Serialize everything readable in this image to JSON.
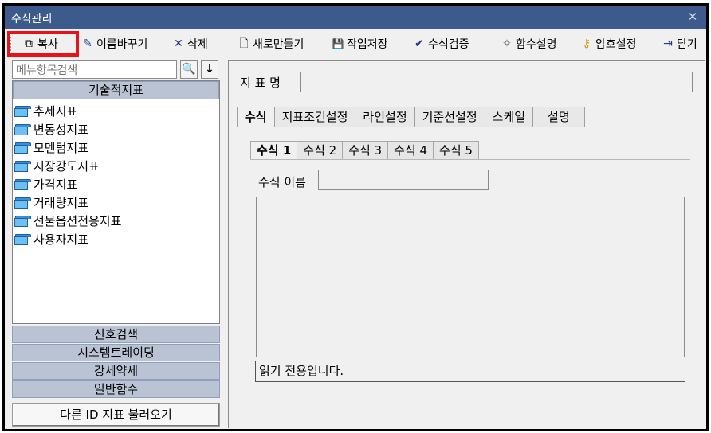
{
  "window": {
    "title": "수식관리",
    "close_glyph": "✕"
  },
  "toolbar": {
    "items": [
      {
        "label": "복사",
        "icon": "copy-icon",
        "glyph": "⧉"
      },
      {
        "label": "이름바꾸기",
        "icon": "rename-icon",
        "glyph": "✎"
      },
      {
        "label": "삭제",
        "icon": "delete-icon",
        "glyph": "✕"
      },
      {
        "label": "새로만들기",
        "icon": "new-document-icon",
        "glyph": "🗋"
      },
      {
        "label": "작업저장",
        "icon": "save-icon",
        "glyph": "💾"
      },
      {
        "label": "수식검증",
        "icon": "checkmark-icon",
        "glyph": "✔"
      },
      {
        "label": "함수설명",
        "icon": "magic-wand-icon",
        "glyph": "✧"
      },
      {
        "label": "암호설정",
        "icon": "key-icon",
        "glyph": "⚷"
      },
      {
        "label": "닫기",
        "icon": "exit-door-icon",
        "glyph": "⇥"
      }
    ],
    "highlight_color": "#e8121a"
  },
  "left": {
    "search_placeholder": "메뉴항목검색",
    "search_glyph": "🔍",
    "down_glyph": "↓",
    "active_category": "기술적지표",
    "tree_items": [
      "추세지표",
      "변동성지표",
      "모멘텀지표",
      "시장강도지표",
      "가격지표",
      "거래량지표",
      "선물옵션전용지표",
      "사용자지표"
    ],
    "categories": [
      "신호검색",
      "시스템트레이딩",
      "강세약세",
      "일반함수"
    ],
    "load_button": "다른 ID 지표 불러오기"
  },
  "right": {
    "indicator_name_label": "지 표 명",
    "indicator_name_value": "",
    "tabs": [
      "수식",
      "지표조건설정",
      "라인설정",
      "기준선설정",
      "스케일",
      "설명"
    ],
    "active_tab": 0,
    "subtabs": [
      "수식 1",
      "수식 2",
      "수식 3",
      "수식 4",
      "수식 5"
    ],
    "active_subtab": 0,
    "formula_name_label": "수식 이름",
    "formula_name_value": "",
    "status_text": "읽기 전용입니다."
  },
  "colors": {
    "titlebar": "#3d5a8c",
    "category_header": "#b9c3d4",
    "folder": "#6cc0f4"
  }
}
